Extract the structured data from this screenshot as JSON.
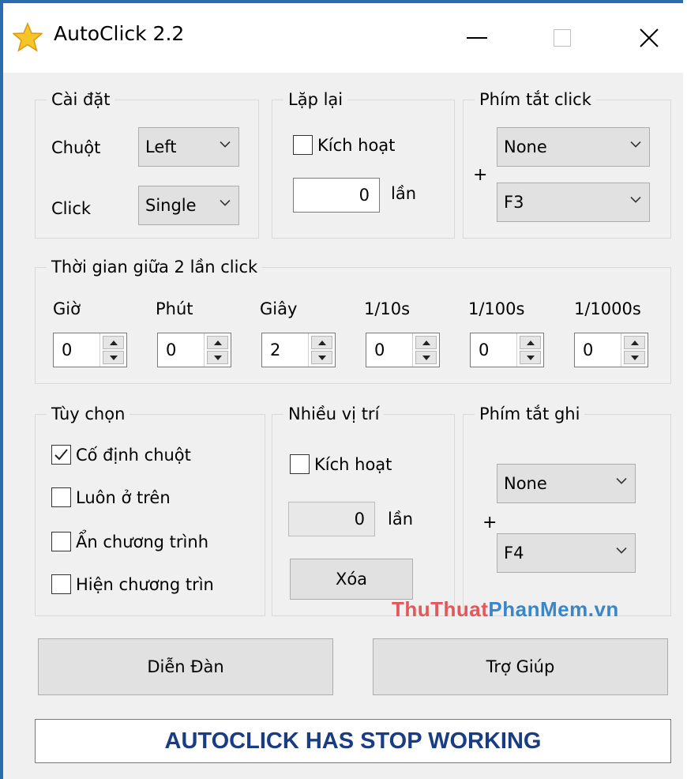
{
  "window": {
    "title": "AutoClick 2.2",
    "min_glyph": "—",
    "close_glyph": "✕"
  },
  "settings": {
    "title": "Cài đặt",
    "mouse_label": "Chuột",
    "mouse_value": "Left",
    "click_label": "Click",
    "click_value": "Single"
  },
  "repeat": {
    "title": "Lặp lại",
    "enable_label": "Kích hoạt",
    "enabled": false,
    "count_value": "0",
    "unit": "lần"
  },
  "hotkey_click": {
    "title": "Phím tắt click",
    "modifier": "None",
    "plus": "+",
    "key": "F3"
  },
  "interval": {
    "title": "Thời gian giữa 2 lần click",
    "fields": [
      {
        "label": "Giờ",
        "value": "0"
      },
      {
        "label": "Phút",
        "value": "0"
      },
      {
        "label": "Giây",
        "value": "2"
      },
      {
        "label": "1/10s",
        "value": "0"
      },
      {
        "label": "1/100s",
        "value": "0"
      },
      {
        "label": "1/1000s",
        "value": "0"
      }
    ]
  },
  "options": {
    "title": "Tùy chọn",
    "items": [
      {
        "label": "Cố định chuột",
        "checked": true
      },
      {
        "label": "Luôn ở trên",
        "checked": false
      },
      {
        "label": "Ẩn chương trình",
        "checked": false
      },
      {
        "label": "Hiện chương trìn",
        "checked": false
      }
    ]
  },
  "multi_pos": {
    "title": "Nhiều vị trí",
    "enable_label": "Kích hoạt",
    "enabled": false,
    "count_value": "0",
    "unit": "lần",
    "clear_label": "Xóa"
  },
  "hotkey_record": {
    "title": "Phím tắt ghi",
    "modifier": "None",
    "plus": "+",
    "key": "F4"
  },
  "watermark": {
    "part1": "ThuThuat",
    "part2": "PhanMem.vn"
  },
  "buttons": {
    "forum_label": "Diễn Đàn",
    "help_label": "Trợ Giúp"
  },
  "status": {
    "text": "AUTOCLICK HAS STOP WORKING",
    "color": "#1a3c82"
  },
  "colors": {
    "window_border": "#2b6cb0",
    "watermark_red": "#e2575a",
    "watermark_blue": "#3a86c8"
  }
}
